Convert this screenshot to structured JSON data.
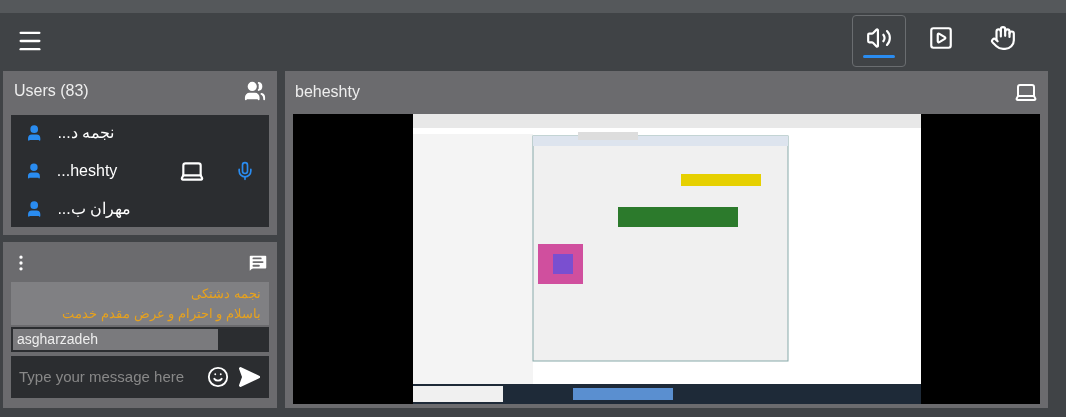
{
  "toolbar": {
    "buttons": [
      {
        "kind": "audio",
        "selected": true
      },
      {
        "kind": "present",
        "selected": false
      },
      {
        "kind": "hand",
        "selected": false
      }
    ]
  },
  "users": {
    "title": "Users (83)",
    "items": [
      {
        "name": "نجمه د...",
        "presenter": false,
        "mic": false
      },
      {
        "name": "...heshty",
        "presenter": true,
        "mic": true
      },
      {
        "name": "مهران ب...",
        "presenter": false,
        "mic": false
      }
    ]
  },
  "chat": {
    "messages": [
      {
        "sender": "نجمه دشتکی",
        "text": "باسلام و احترام و عرض مقدم خدمت"
      }
    ],
    "tooltip": "asgharzadeh",
    "input": {
      "placeholder": "Type your message here"
    }
  },
  "presentation": {
    "title": "beheshty"
  }
}
